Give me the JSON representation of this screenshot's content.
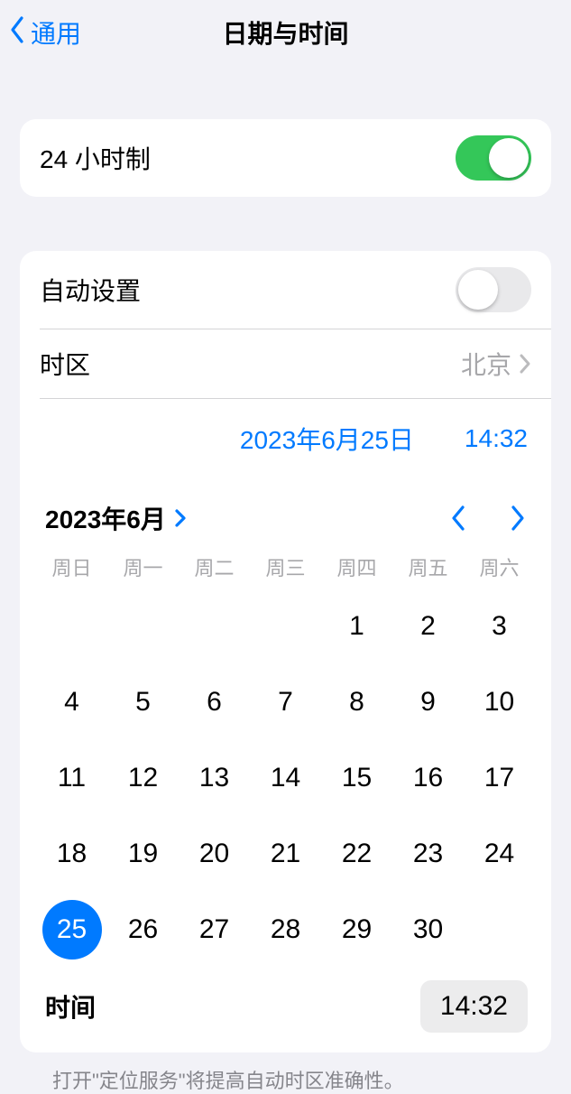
{
  "nav": {
    "back_label": "通用",
    "title": "日期与时间"
  },
  "row_24h": {
    "label": "24 小时制",
    "on": true
  },
  "auto": {
    "label": "自动设置",
    "on": false
  },
  "timezone": {
    "label": "时区",
    "value": "北京"
  },
  "datetime_display": {
    "date": "2023年6月25日",
    "time": "14:32"
  },
  "calendar": {
    "header": "2023年6月",
    "weekdays": [
      "周日",
      "周一",
      "周二",
      "周三",
      "周四",
      "周五",
      "周六"
    ],
    "lead_blanks": 4,
    "days": [
      1,
      2,
      3,
      4,
      5,
      6,
      7,
      8,
      9,
      10,
      11,
      12,
      13,
      14,
      15,
      16,
      17,
      18,
      19,
      20,
      21,
      22,
      23,
      24,
      25,
      26,
      27,
      28,
      29,
      30
    ],
    "selected": 25
  },
  "time_row": {
    "label": "时间",
    "value": "14:32"
  },
  "footnote": "打开\"定位服务\"将提高自动时区准确性。"
}
